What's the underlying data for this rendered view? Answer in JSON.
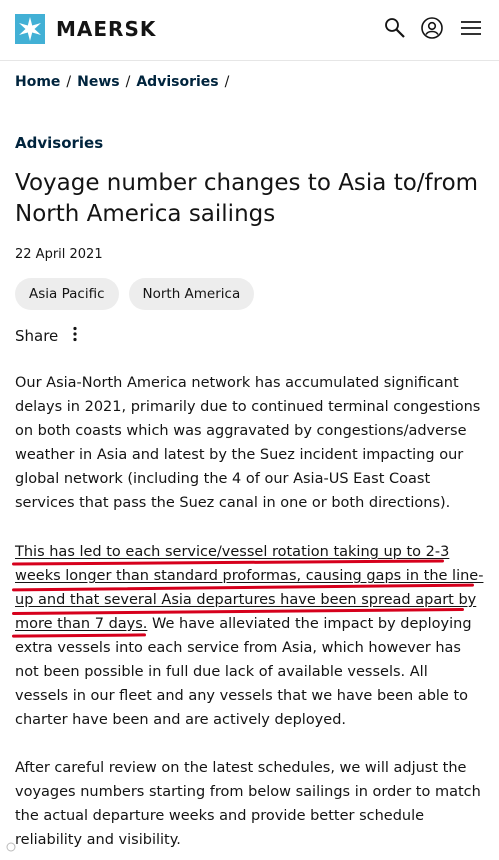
{
  "header": {
    "brand": "MAERSK",
    "brand_color": "#42b0d5",
    "icons": [
      "search-icon",
      "user-icon",
      "menu-icon"
    ]
  },
  "breadcrumb": {
    "items": [
      "Home",
      "News",
      "Advisories"
    ],
    "separator": "/"
  },
  "article": {
    "category": "Advisories",
    "title": "Voyage number changes to Asia to/from North America sailings",
    "date": "22 April 2021",
    "tags": [
      "Asia Pacific",
      "North America"
    ],
    "share_label": "Share",
    "paragraph1": "Our Asia-North America network has accumulated significant delays in 2021, primarily due to continued terminal congestions on both coasts which was aggravated by congestions/adverse weather in Asia and latest by the Suez incident impacting our global network (including the 4 of our Asia-US East Coast services that pass the Suez canal in one or both directions).",
    "paragraph2_highlight": "This has led to each service/vessel rotation taking up to 2-3 weeks longer than standard proformas, causing gaps in the line-up and that several Asia departures have been spread apart by more than 7 days.",
    "paragraph2_rest": " We have alleviated the impact by deploying extra vessels into each service from Asia, which however has not been possible in full due lack of available vessels. All vessels in our fleet and any vessels that we have been able to charter have been and are actively deployed.",
    "paragraph3": "After careful review on the latest schedules, we will adjust the voyages numbers starting from below sailings in order to match the actual departure weeks and provide better schedule reliability and visibility."
  },
  "annotation_color": "#d6001c"
}
